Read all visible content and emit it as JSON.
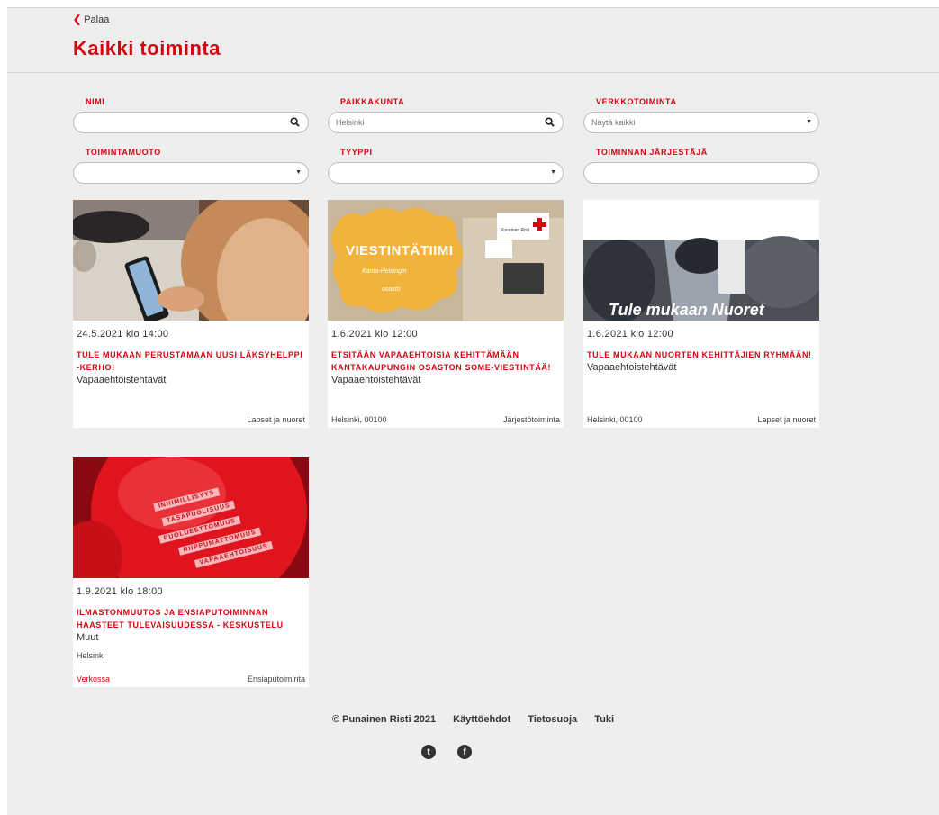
{
  "header": {
    "back_label": "Palaa",
    "title": "Kaikki toiminta"
  },
  "filters": {
    "name": {
      "label": "NIMI",
      "value": ""
    },
    "location": {
      "label": "PAIKKAKUNTA",
      "value": "Helsinki"
    },
    "online": {
      "label": "VERKKOTOIMINTA",
      "value": "Näytä kaikki"
    },
    "form": {
      "label": "TOIMINTAMUOTO",
      "value": ""
    },
    "type": {
      "label": "TYYPPI",
      "value": ""
    },
    "organizer": {
      "label": "TOIMINNAN JÄRJESTÄJÄ",
      "value": ""
    }
  },
  "cards": [
    {
      "date": "24.5.2021 klo 14:00",
      "title": "TULE MUKAAN PERUSTAMAAN UUSI LÄKSYHELPPI -KERHO!",
      "category": "Vapaaehtoistehtävät",
      "location": "",
      "tag": "Lapset ja nuoret"
    },
    {
      "date": "1.6.2021 klo 12:00",
      "title": "ETSITÄÄN VAPAAEHTOISIA KEHITTÄMÄÄN KANTAKAUPUNGIN OSASTON SOME-VIESTINTÄÄ!",
      "category": "Vapaaehtoistehtävät",
      "location": "Helsinki, 00100",
      "tag": "Järjestötoiminta",
      "image_text": {
        "headline": "VIESTINTÄTIIMI",
        "sub1": "Kanta-Helsingin",
        "sub2": "osasto",
        "brand": "Punainen Risti"
      }
    },
    {
      "date": "1.6.2021 klo 12:00",
      "title": "TULE MUKAAN NUORTEN KEHITTÄJIEN RYHMÄÄN!",
      "category": "Vapaaehtoistehtävät",
      "location": "Helsinki, 00100",
      "tag": "Lapset ja nuoret",
      "image_text": {
        "overlay": "Tule mukaan Nuoret"
      }
    },
    {
      "date": "1.9.2021 klo 18:00",
      "title": "ILMASTONMUUTOS JA ENSIAPUTOIMINNAN HAASTEET TULEVAISUUDESSA - KESKUSTELU",
      "category": "Muut",
      "location": "Helsinki",
      "online": "Verkossa",
      "tag": "Ensiaputoiminta",
      "image_text": {
        "w1": "INHIMILLISYYS",
        "w2": "TASAPUOLISUUS",
        "w3": "PUOLUEETTOMUUS",
        "w4": "RIIPPUMATTOMUUS",
        "w5": "VAPAAEHTOISUUS"
      }
    }
  ],
  "footer": {
    "copyright": "© Punainen Risti 2021",
    "links": [
      "Käyttöehdot",
      "Tietosuoja",
      "Tuki"
    ],
    "social_icons": [
      "twitter-icon",
      "facebook-icon"
    ]
  },
  "colors": {
    "accent": "#d40511",
    "background": "#eeeeee"
  }
}
